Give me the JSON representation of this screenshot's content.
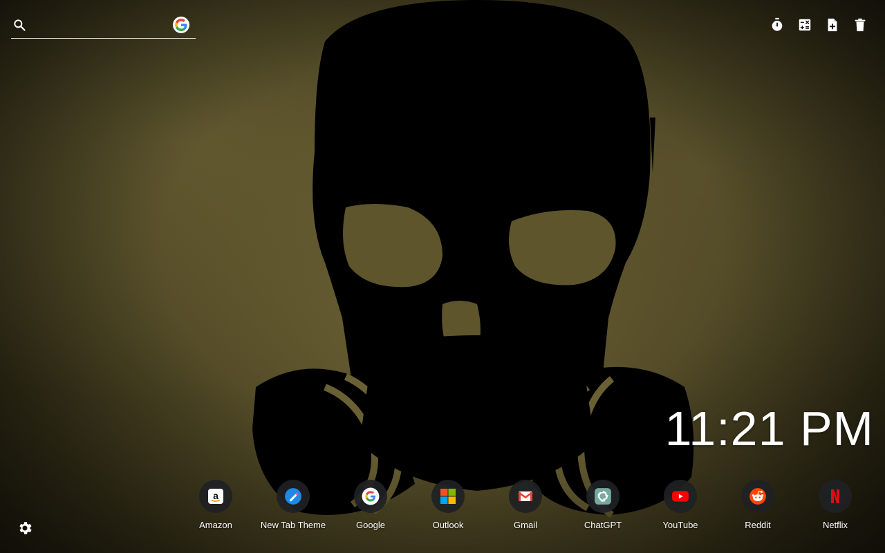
{
  "search": {
    "value": "",
    "placeholder": "",
    "engine_icon": "google-g-icon"
  },
  "toolbar": {
    "icons": [
      "stopwatch-icon",
      "calculator-icon",
      "new-note-icon",
      "trash-icon"
    ]
  },
  "clock": {
    "time": "11:21 PM"
  },
  "shortcuts": [
    {
      "label": "Amazon",
      "icon": "amazon-icon"
    },
    {
      "label": "New Tab Theme",
      "icon": "new-tab-theme-icon"
    },
    {
      "label": "Google",
      "icon": "google-icon"
    },
    {
      "label": "Outlook",
      "icon": "microsoft-icon"
    },
    {
      "label": "Gmail",
      "icon": "gmail-icon"
    },
    {
      "label": "ChatGPT",
      "icon": "chatgpt-icon"
    },
    {
      "label": "YouTube",
      "icon": "youtube-icon"
    },
    {
      "label": "Reddit",
      "icon": "reddit-icon"
    },
    {
      "label": "Netflix",
      "icon": "netflix-icon"
    }
  ],
  "settings": {
    "icon": "gear-icon"
  },
  "colors": {
    "google_blue": "#4285F4",
    "google_red": "#EA4335",
    "google_yellow": "#FBBC05",
    "google_green": "#34A853",
    "youtube_red": "#FF0000",
    "reddit_orange": "#FF4500",
    "netflix_red": "#E50914",
    "chatgpt_teal": "#74AA9C"
  }
}
